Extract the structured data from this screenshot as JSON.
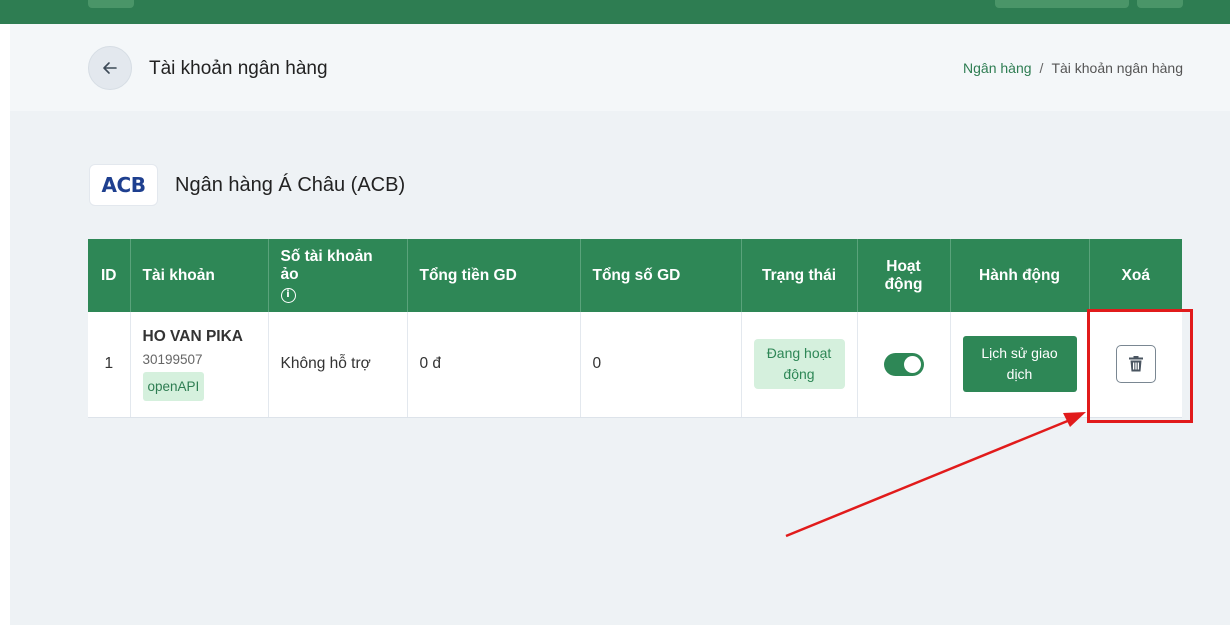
{
  "header": {
    "title": "Tài khoản ngân hàng",
    "breadcrumb": {
      "parent": "Ngân hàng",
      "separator": "/",
      "current": "Tài khoản ngân hàng"
    }
  },
  "bank": {
    "logo_text": "ACB",
    "name": "Ngân hàng Á Châu (ACB)"
  },
  "table": {
    "columns": {
      "id": "ID",
      "account": "Tài khoản",
      "virtual_account": "Số tài khoản ảo",
      "total_amount": "Tổng tiền GD",
      "total_count": "Tổng số GD",
      "status": "Trạng thái",
      "active": "Hoạt động",
      "action": "Hành động",
      "delete": "Xoá"
    },
    "rows": [
      {
        "id": "1",
        "account_name": "HO VAN PIKA",
        "account_number": "30199507",
        "account_tag": "openAPI",
        "virtual_account": "Không hỗ trợ",
        "total_amount": "0 đ",
        "total_count": "0",
        "status": "Đang hoạt động",
        "active": true,
        "action_label": "Lịch sử giao dịch"
      }
    ]
  },
  "annotation": {
    "color": "#e11b1b"
  },
  "icons": {
    "back": "arrow-left-icon",
    "info": "info-icon",
    "delete": "trash-icon"
  },
  "colors": {
    "topbar": "#2e7d52",
    "header_bg": "#2e8756",
    "badge_bg": "#d5f0dd"
  }
}
